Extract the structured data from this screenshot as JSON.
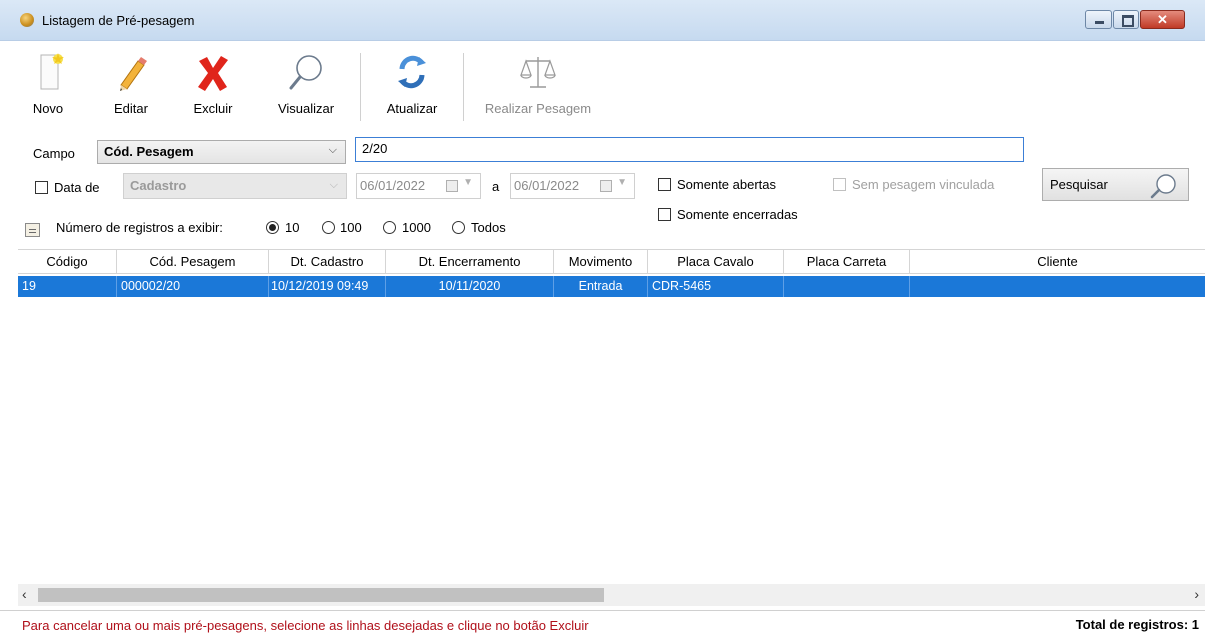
{
  "window": {
    "title": "Listagem de Pré-pesagem"
  },
  "toolbar": {
    "novo": "Novo",
    "editar": "Editar",
    "excluir": "Excluir",
    "visualizar": "Visualizar",
    "atualizar": "Atualizar",
    "realizar_pesagem": "Realizar Pesagem"
  },
  "filters": {
    "campo_label": "Campo",
    "campo_value": "Cód. Pesagem",
    "search_value": "2/20",
    "data_de_label": "Data de",
    "data_de_checked": false,
    "data_field_value": "Cadastro",
    "date_from": "06/01/2022",
    "date_separator": "a",
    "date_to": "06/01/2022",
    "somente_abertas": "Somente abertas",
    "somente_encerradas": "Somente encerradas",
    "sem_pesagem_vinculada": "Sem pesagem vinculada",
    "pesquisar": "Pesquisar",
    "registros_label": "Número de registros a exibir:",
    "registros_options": [
      "10",
      "100",
      "1000",
      "Todos"
    ],
    "registros_selected": "10"
  },
  "grid": {
    "columns": [
      "Código",
      "Cód. Pesagem",
      "Dt. Cadastro",
      "Dt. Encerramento",
      "Movimento",
      "Placa Cavalo",
      "Placa Carreta",
      "Cliente"
    ],
    "rows": [
      {
        "codigo": "19",
        "cod_pesagem": "000002/20",
        "dt_cadastro": "10/12/2019 09:49",
        "dt_encerramento": "10/11/2020",
        "movimento": "Entrada",
        "placa_cavalo": "CDR-5465",
        "placa_carreta": "",
        "cliente": ""
      }
    ]
  },
  "status": {
    "message": "Para cancelar uma ou mais pré-pesagens, selecione as linhas desejadas e clique no botão Excluir",
    "total": "Total de registros: 1"
  },
  "colors": {
    "selection": "#1b78d8",
    "status_message": "#b0101a",
    "title_bar": "#c6daf0"
  }
}
